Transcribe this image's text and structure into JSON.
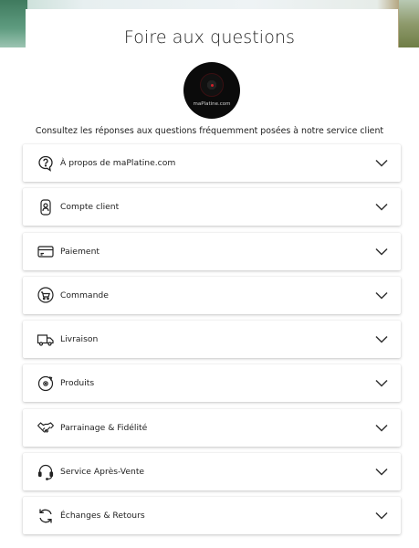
{
  "page": {
    "title": "Foire aux questions",
    "subtitle": "Consultez les réponses aux questions fréquemment posées à notre service client"
  },
  "logo": {
    "brand_text": "maPlatine.com"
  },
  "faq": [
    {
      "label": "À propos de maPlatine.com",
      "icon": "help-bubble-icon"
    },
    {
      "label": "Compte client",
      "icon": "user-account-icon"
    },
    {
      "label": "Paiement",
      "icon": "credit-card-icon"
    },
    {
      "label": "Commande",
      "icon": "shopping-cart-icon"
    },
    {
      "label": "Livraison",
      "icon": "delivery-truck-icon"
    },
    {
      "label": "Produits",
      "icon": "vinyl-record-icon"
    },
    {
      "label": "Parrainage & Fidélité",
      "icon": "handshake-icon"
    },
    {
      "label": "Service Après-Vente",
      "icon": "headset-icon"
    },
    {
      "label": "Échanges & Retours",
      "icon": "exchange-arrows-icon"
    }
  ]
}
